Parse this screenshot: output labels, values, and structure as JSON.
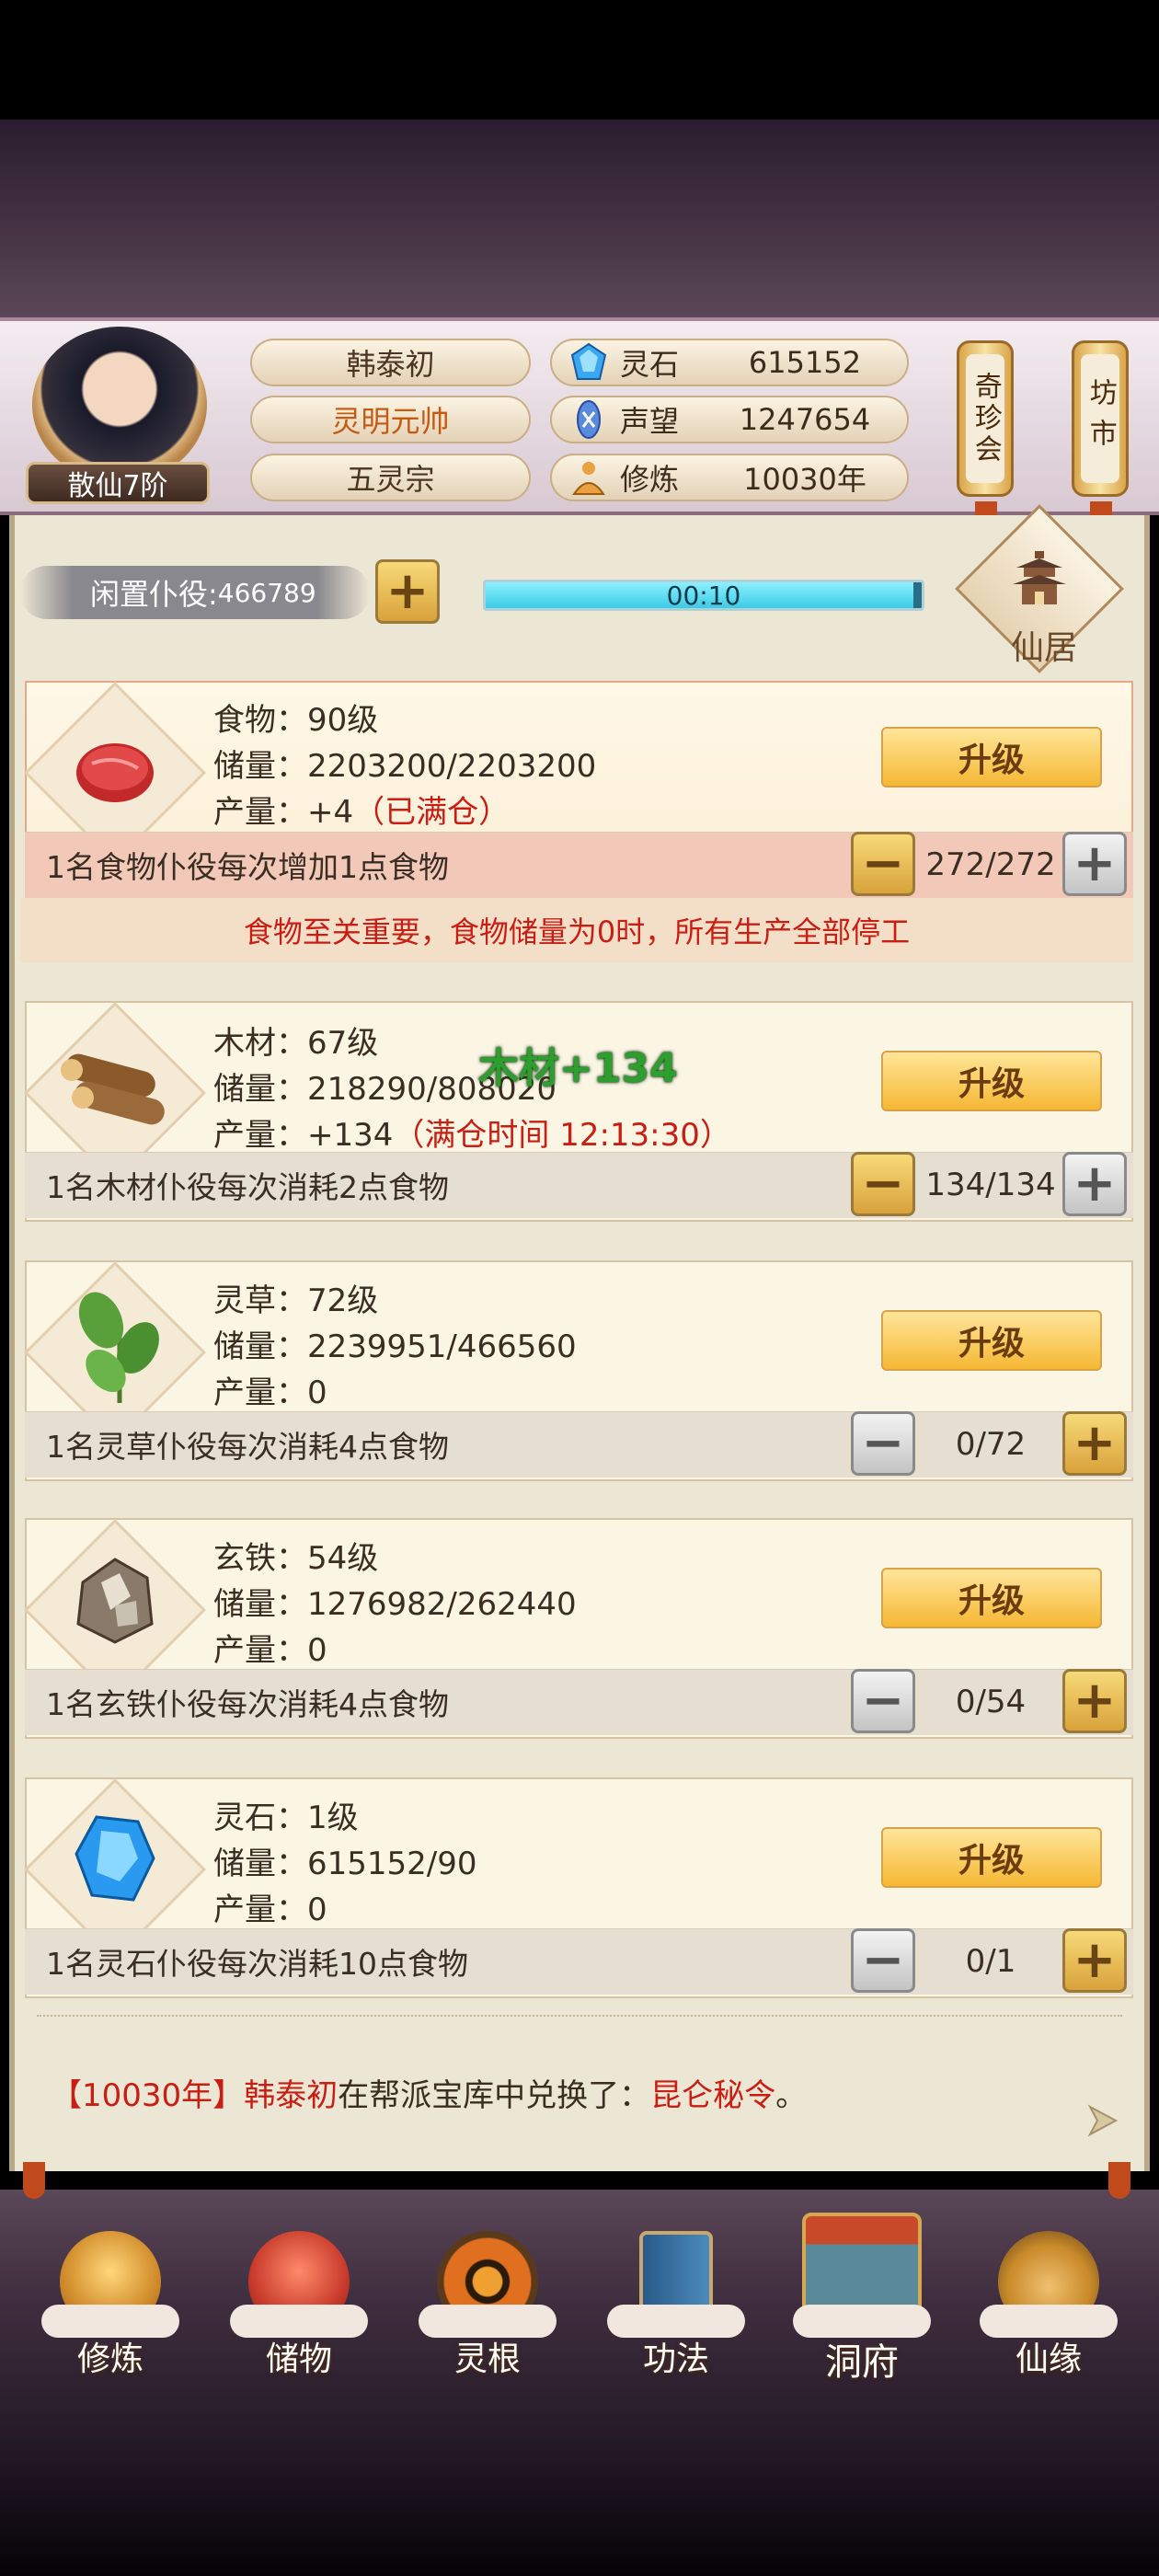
{
  "player": {
    "name": "韩泰初",
    "title": "灵明元帅",
    "sect": "五灵宗",
    "rank": "散仙7阶"
  },
  "resources": [
    {
      "label": "灵石",
      "value": "615152",
      "icon": "spirit-stone-icon"
    },
    {
      "label": "声望",
      "value": "1247654",
      "icon": "prestige-icon"
    },
    {
      "label": "修炼",
      "value": "10030年",
      "icon": "cultivation-icon"
    }
  ],
  "side_buttons": {
    "treasure": "奇珍会",
    "market": "坊市"
  },
  "idle": {
    "label": "闲置仆役:",
    "value": "466789",
    "plus": "+"
  },
  "timer": {
    "text": "00:10",
    "progress": 0.98
  },
  "xianju": "仙居",
  "cards": [
    {
      "key": "food",
      "name_line": "食物：90级",
      "storage_line": "储量：2203200/2203200",
      "output_prefix": "产量：+4",
      "output_note": "（已满仓）",
      "upgrade": "升级",
      "worker_text": "1名食物仆役每次增加1点食物",
      "count": "272/272",
      "minus": "−",
      "plus": "+",
      "icon": "meat-icon"
    },
    {
      "key": "wood",
      "name_line": "木材：67级",
      "storage_line": "储量：218290/808020",
      "output_prefix": "产量：+134",
      "output_note": "（满仓时间 12:13:30）",
      "upgrade": "升级",
      "worker_text": "1名木材仆役每次消耗2点食物",
      "count": "134/134",
      "minus": "−",
      "plus": "+",
      "icon": "wood-logs-icon"
    },
    {
      "key": "herb",
      "name_line": "灵草：72级",
      "storage_line": "储量：2239951/466560",
      "output_prefix": "产量：0",
      "output_note": "",
      "upgrade": "升级",
      "worker_text": "1名灵草仆役每次消耗4点食物",
      "count": "0/72",
      "minus": "−",
      "plus": "+",
      "icon": "herb-icon"
    },
    {
      "key": "iron",
      "name_line": "玄铁：54级",
      "storage_line": "储量：1276982/262440",
      "output_prefix": "产量：0",
      "output_note": "",
      "upgrade": "升级",
      "worker_text": "1名玄铁仆役每次消耗4点食物",
      "count": "0/54",
      "minus": "−",
      "plus": "+",
      "icon": "iron-ore-icon"
    },
    {
      "key": "stone",
      "name_line": "灵石：1级",
      "storage_line": "储量：615152/90",
      "output_prefix": "产量：0",
      "output_note": "",
      "upgrade": "升级",
      "worker_text": "1名灵石仆役每次消耗10点食物",
      "count": "0/1",
      "minus": "−",
      "plus": "+",
      "icon": "spirit-crystal-icon"
    }
  ],
  "notice": "食物至关重要，食物储量为0时，所有生产全部停工",
  "floating_text": "木材+134",
  "log": {
    "year": "【10030年】",
    "name": "韩泰初",
    "mid": "在帮派宝库中兑换了：",
    "item": "昆仑秘令",
    "end": "。"
  },
  "nav": [
    {
      "label": "修炼",
      "icon": "cultivation-nav-icon"
    },
    {
      "label": "储物",
      "icon": "storage-bag-icon"
    },
    {
      "label": "灵根",
      "icon": "spirit-root-icon"
    },
    {
      "label": "功法",
      "icon": "scripture-book-icon"
    },
    {
      "label": "洞府",
      "icon": "cave-mansion-icon"
    },
    {
      "label": "仙缘",
      "icon": "fate-gourd-icon"
    }
  ],
  "colors": {
    "accent_red": "#c81e14",
    "gold_button": "#f5b834",
    "title_orange": "#c55a12",
    "timer_fill": "#3ccbe6"
  }
}
